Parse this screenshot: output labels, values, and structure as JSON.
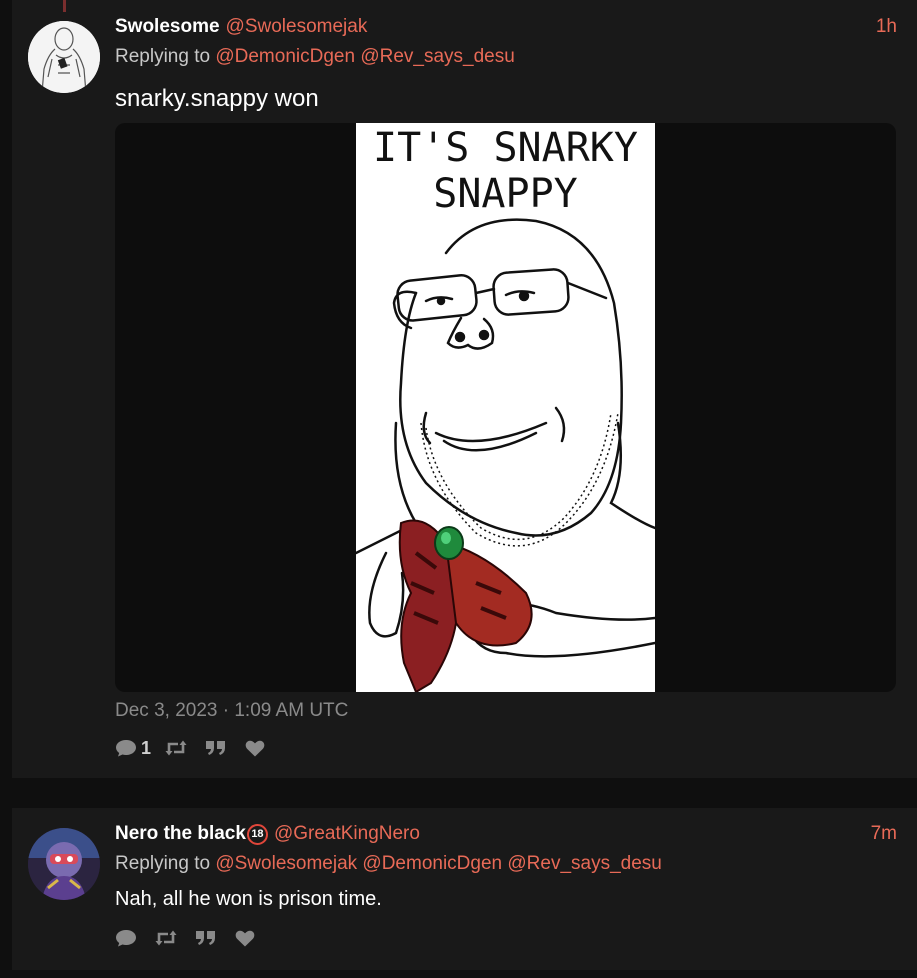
{
  "tweets": [
    {
      "fullname": "Swolesome",
      "username": "@Swolesomejak",
      "time": "1h",
      "replying_prefix": "Replying to",
      "replying_to": [
        "@DemonicDgen",
        "@Rev_says_desu"
      ],
      "content": "snarky.snappy won",
      "media": {
        "caption": "IT'S SNARKY\nSNAPPY"
      },
      "date": "Dec 3, 2023 · 1:09 AM UTC",
      "stats": {
        "replies": "1",
        "retweets": "",
        "quotes": "",
        "likes": ""
      }
    },
    {
      "fullname": "Nero the black",
      "badge": "18",
      "username": "@GreatKingNero",
      "time": "7m",
      "replying_prefix": "Replying to",
      "replying_to": [
        "@Swolesomejak",
        "@DemonicDgen",
        "@Rev_says_desu"
      ],
      "content": "Nah, all he won is prison time.",
      "stats": {
        "replies": "",
        "retweets": "",
        "quotes": "",
        "likes": ""
      }
    }
  ],
  "colors": {
    "accent": "#e86a57",
    "card": "#191919",
    "background": "#0f0f0f",
    "muted": "#8a8a8a"
  },
  "icons": [
    "comment-icon",
    "retweet-icon",
    "quote-icon",
    "heart-icon"
  ]
}
